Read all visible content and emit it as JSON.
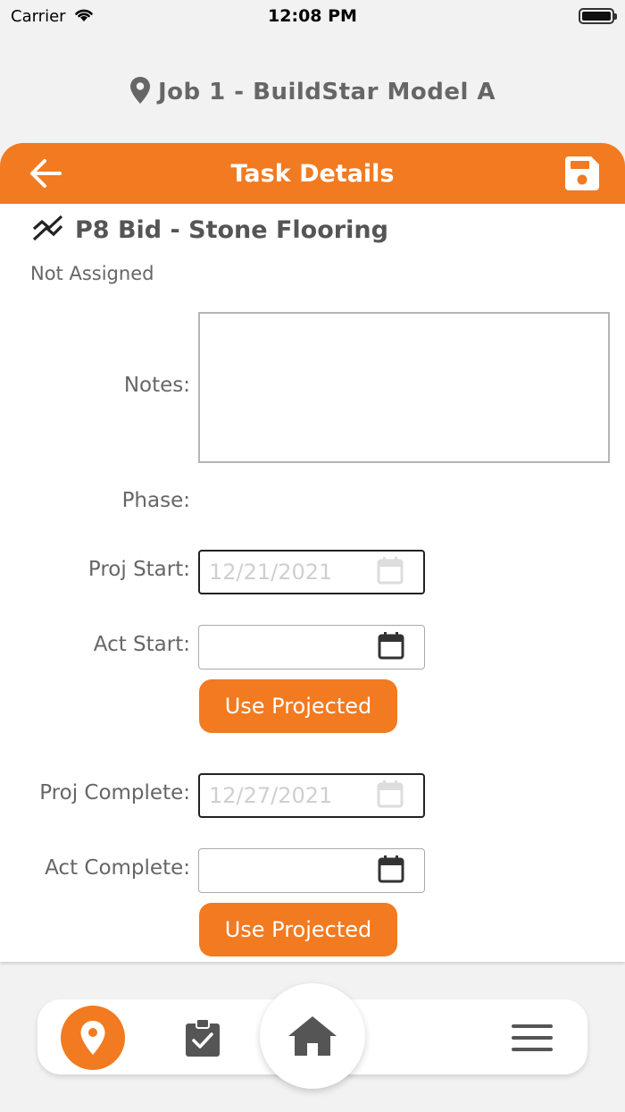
{
  "status_bar": {
    "carrier": "Carrier",
    "time": "12:08 PM"
  },
  "job": {
    "title": "Job 1 - BuildStar Model A"
  },
  "panel": {
    "title": "Task Details",
    "task_name": "P8 Bid - Stone Flooring",
    "assigned": "Not Assigned"
  },
  "form": {
    "notes_label": "Notes:",
    "notes_value": "",
    "phase_label": "Phase:",
    "phase_value": "",
    "proj_start_label": "Proj Start:",
    "proj_start_value": "12/21/2021",
    "act_start_label": "Act Start:",
    "act_start_value": "",
    "use_projected_start": "Use Projected",
    "proj_complete_label": "Proj Complete:",
    "proj_complete_value": "12/27/2021",
    "act_complete_label": "Act Complete:",
    "act_complete_value": "",
    "use_projected_complete": "Use Projected"
  },
  "colors": {
    "accent": "#f27a20",
    "icon_gray": "#555555"
  },
  "icons": {
    "back": "arrow-left-icon",
    "save": "floppy-disk-icon",
    "task_type": "zigzag-lines-icon",
    "location": "map-pin-icon",
    "calendar": "calendar-icon",
    "tasks": "clipboard-check-icon",
    "home": "home-icon",
    "menu": "hamburger-menu-icon"
  }
}
